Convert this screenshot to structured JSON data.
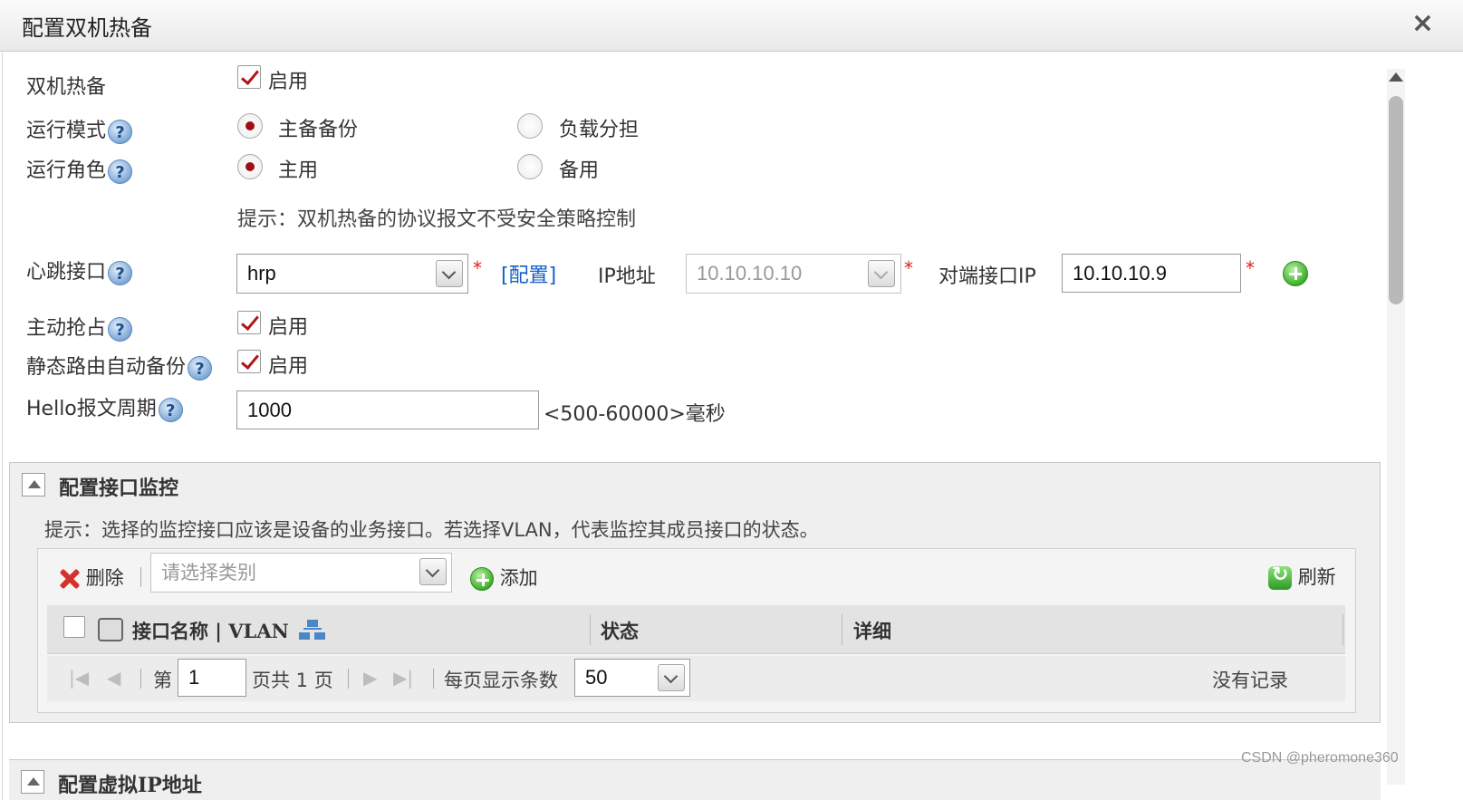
{
  "dialog": {
    "title": "配置双机热备",
    "close": "×"
  },
  "form": {
    "hot_standby": {
      "label": "双机热备",
      "check_label": "启用"
    },
    "run_mode": {
      "label": "运行模式",
      "opt1": "主备备份",
      "opt2": "负载分担"
    },
    "run_role": {
      "label": "运行角色",
      "opt1": "主用",
      "opt2": "备用"
    },
    "tip": "提示：双机热备的协议报文不受安全策略控制",
    "heartbeat": {
      "label": "心跳接口",
      "value": "hrp",
      "config_link": "[配置]",
      "ip_label": "IP地址",
      "ip_value": "10.10.10.10",
      "peer_label": "对端接口IP",
      "peer_value": "10.10.10.9",
      "required": "*"
    },
    "preempt": {
      "label": "主动抢占",
      "check_label": "启用"
    },
    "static_backup": {
      "label": "静态路由自动备份",
      "check_label": "启用"
    },
    "hello": {
      "label": "Hello报文周期",
      "value": "1000",
      "range": "<500-60000>毫秒"
    },
    "help": "?"
  },
  "monitor_panel": {
    "title": "配置接口监控",
    "tip": "提示：选择的监控接口应该是设备的业务接口。若选择VLAN，代表监控其成员接口的状态。",
    "toolbar": {
      "delete": "删除",
      "category_placeholder": "请选择类别",
      "add": "添加",
      "refresh": "刷新"
    },
    "columns": [
      "接口名称 | VLAN",
      "状态",
      "详细"
    ],
    "pager": {
      "page_prefix": "第",
      "page": "1",
      "page_suffix": "页共 1 页",
      "per_page_label": "每页显示条数",
      "per_page": "50",
      "no_records": "没有记录"
    }
  },
  "next_panel": {
    "title": "配置虚拟IP地址"
  },
  "watermark": "CSDN @pheromone360"
}
